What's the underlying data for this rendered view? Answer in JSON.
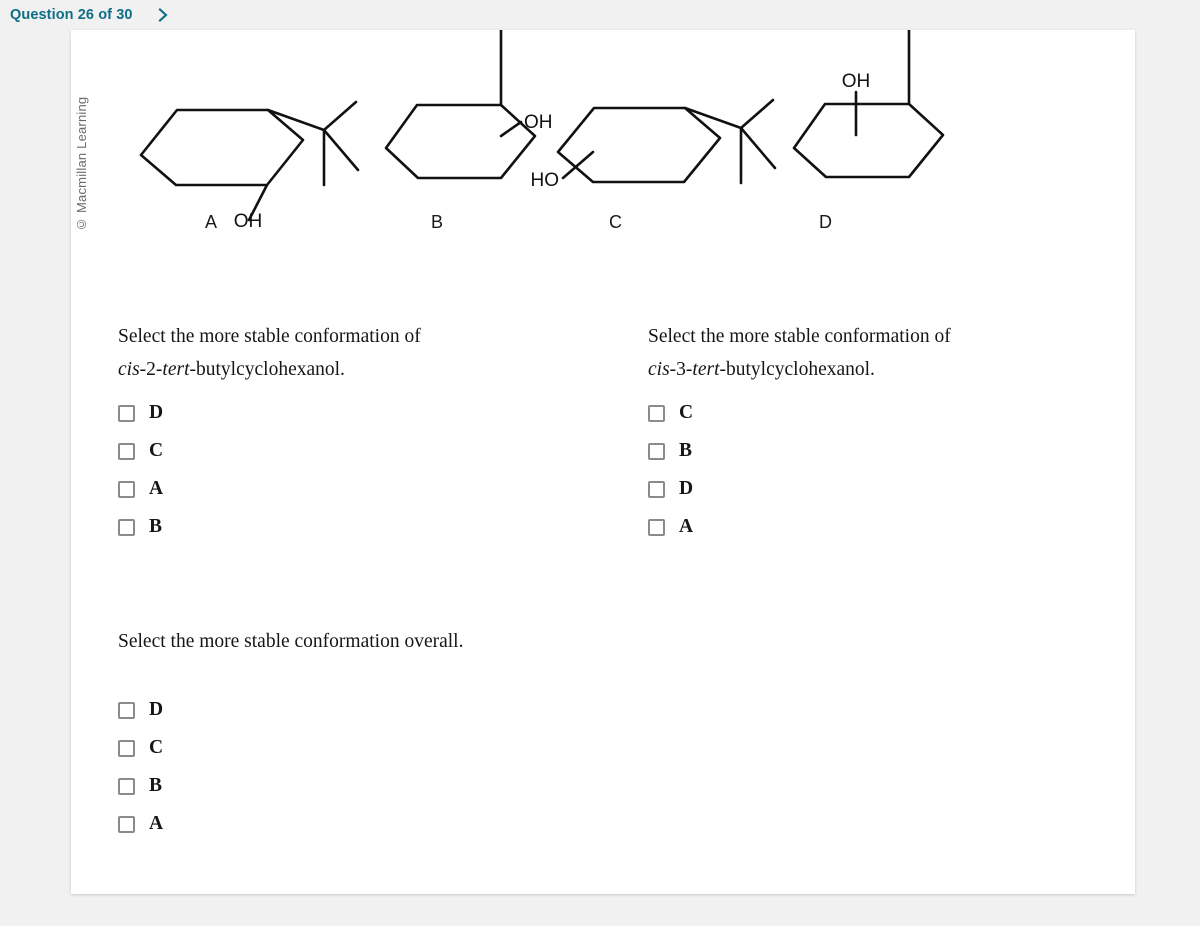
{
  "header": {
    "question_label": "Question 26 of 30",
    "next_icon": "chevron-right-icon",
    "accent_color": "#0d6e86"
  },
  "credit": {
    "text": "© Macmillan Learning"
  },
  "structures": [
    {
      "id": "A",
      "label": "A",
      "substituent": "tert-butyl",
      "substituent_position": "equatorial",
      "hydroxyl_label": "OH",
      "hydroxyl_position": "axial-down",
      "hydroxyl_side": "right-of-ring-bottom"
    },
    {
      "id": "B",
      "label": "B",
      "substituent": "tert-butyl",
      "substituent_position": "axial-up",
      "hydroxyl_label": "OH",
      "hydroxyl_position": "equatorial",
      "hydroxyl_side": "right"
    },
    {
      "id": "C",
      "label": "C",
      "substituent": "tert-butyl",
      "substituent_position": "equatorial",
      "hydroxyl_label": "HO",
      "hydroxyl_position": "equatorial",
      "hydroxyl_side": "left"
    },
    {
      "id": "D",
      "label": "D",
      "substituent": "tert-butyl",
      "substituent_position": "axial-up",
      "hydroxyl_label": "OH",
      "hydroxyl_position": "axial-up",
      "hydroxyl_side": "left"
    }
  ],
  "questions": [
    {
      "id": "cis-2",
      "prompt_line1": "Select the more stable conformation of",
      "prompt_line2_parts": [
        {
          "text": "cis",
          "italic": true
        },
        {
          "text": "-2-",
          "italic": false
        },
        {
          "text": "tert",
          "italic": true
        },
        {
          "text": "-butylcyclohexanol.",
          "italic": false
        }
      ],
      "options": [
        {
          "label": "D",
          "checked": false
        },
        {
          "label": "C",
          "checked": false
        },
        {
          "label": "A",
          "checked": false
        },
        {
          "label": "B",
          "checked": false
        }
      ]
    },
    {
      "id": "cis-3",
      "prompt_line1": "Select the more stable conformation of",
      "prompt_line2_parts": [
        {
          "text": "cis",
          "italic": true
        },
        {
          "text": "-3-",
          "italic": false
        },
        {
          "text": "tert",
          "italic": true
        },
        {
          "text": "-butylcyclohexanol.",
          "italic": false
        }
      ],
      "options": [
        {
          "label": "C",
          "checked": false
        },
        {
          "label": "B",
          "checked": false
        },
        {
          "label": "D",
          "checked": false
        },
        {
          "label": "A",
          "checked": false
        }
      ]
    },
    {
      "id": "overall",
      "prompt_line1": "Select the more stable conformation overall.",
      "prompt_line2_parts": [],
      "options": [
        {
          "label": "D",
          "checked": false
        },
        {
          "label": "C",
          "checked": false
        },
        {
          "label": "B",
          "checked": false
        },
        {
          "label": "A",
          "checked": false
        }
      ]
    }
  ],
  "colors": {
    "page_background": "#f1f1f1",
    "card_background": "#ffffff",
    "text": "#161616",
    "checkbox_border": "#8b8b8b",
    "bond_stroke": "#111111"
  }
}
